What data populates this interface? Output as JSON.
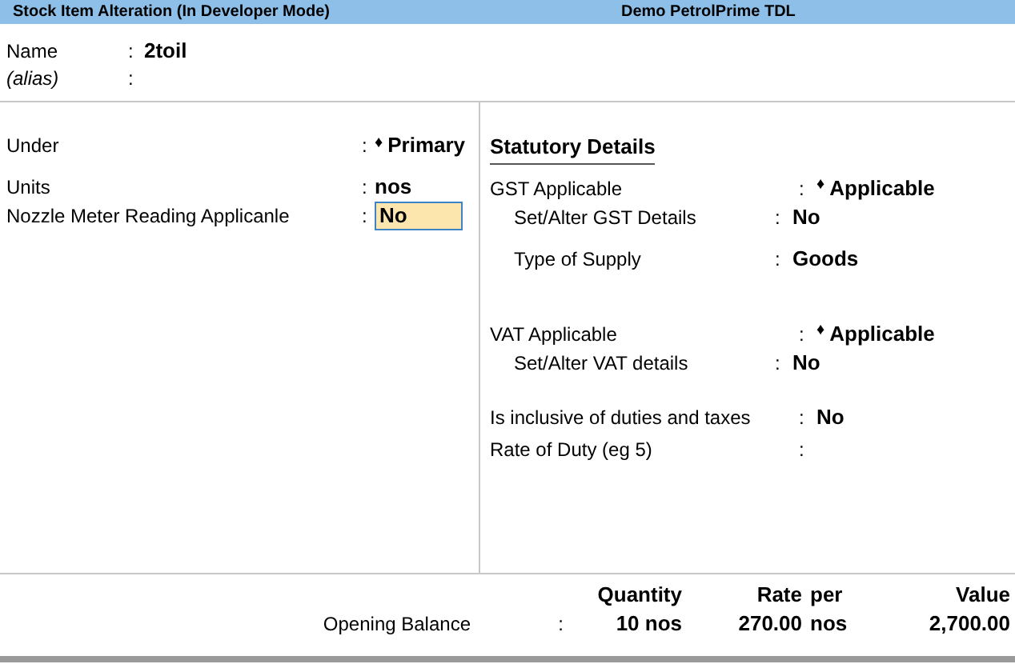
{
  "title_bar": {
    "title": "Stock Item Alteration (In Developer Mode)",
    "company": "Demo PetrolPrime TDL"
  },
  "header_fields": [
    {
      "label": "Name",
      "sep": ":",
      "value": "2toil",
      "italic": false
    },
    {
      "label": "(alias)",
      "sep": ":",
      "italic": true
    }
  ],
  "left_fields": [
    {
      "label": "Under",
      "sep": ":",
      "marker": "♦",
      "value": "Primary",
      "focused": false
    },
    {
      "label": "Units",
      "sep": ":",
      "value": "nos",
      "focused": false
    },
    {
      "label": "Nozzle Meter Reading Applicanle",
      "sep": ":",
      "value": "No",
      "focused": true
    }
  ],
  "statutory": {
    "title": "Statutory Details",
    "items": [
      {
        "label": "GST Applicable",
        "sep": ":",
        "marker": "♦",
        "value": "Applicable",
        "children": [
          {
            "label": "Set/Alter GST Details",
            "sep": ":",
            "value": "No"
          },
          {
            "label": "Type of Supply",
            "sep": ":",
            "value": "Goods"
          }
        ]
      },
      {
        "label": "VAT Applicable",
        "sep": ":",
        "marker": "♦",
        "value": "Applicable",
        "children": [
          {
            "label": "Set/Alter VAT details",
            "sep": ":",
            "value": "No"
          }
        ]
      },
      {
        "label": "Is inclusive of duties and taxes",
        "sep": ":",
        "value": "No"
      },
      {
        "label": "Rate of Duty (eg 5)",
        "sep": ":"
      }
    ]
  },
  "opening_balance": {
    "columns": [
      "Quantity",
      "Rate",
      "per",
      "Value"
    ],
    "label": "Opening Balance",
    "sep": ":",
    "values": [
      "10 nos",
      "270.00",
      "nos",
      "2,700.00"
    ]
  }
}
